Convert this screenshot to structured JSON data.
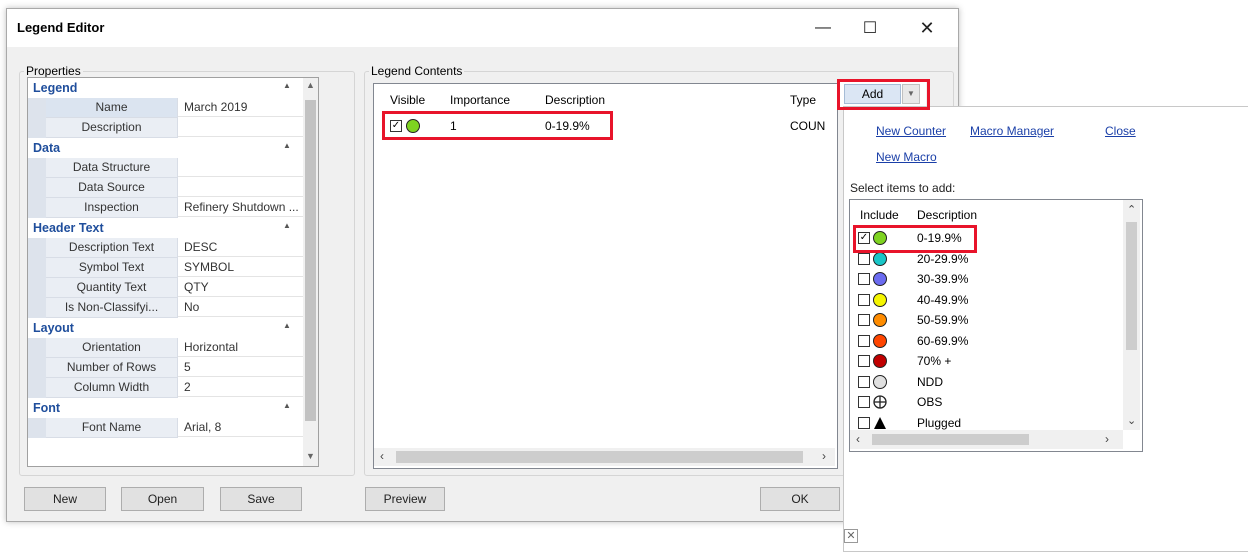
{
  "window": {
    "title": "Legend Editor",
    "minimize_icon": "minimize-icon",
    "maximize_icon": "maximize-icon",
    "close_icon": "close-icon"
  },
  "properties": {
    "group_label": "Properties",
    "categories": [
      {
        "label": "Legend",
        "rows": [
          {
            "name": "Name",
            "value": "March 2019"
          },
          {
            "name": "Description",
            "value": ""
          }
        ]
      },
      {
        "label": "Data",
        "rows": [
          {
            "name": "Data Structure",
            "value": ""
          },
          {
            "name": "Data Source",
            "value": ""
          },
          {
            "name": "Inspection",
            "value": "Refinery Shutdown ..."
          }
        ]
      },
      {
        "label": "Header Text",
        "rows": [
          {
            "name": "Description Text",
            "value": "DESC"
          },
          {
            "name": "Symbol Text",
            "value": "SYMBOL"
          },
          {
            "name": "Quantity Text",
            "value": "QTY"
          },
          {
            "name": "Is Non-Classifyi...",
            "value": "No"
          }
        ]
      },
      {
        "label": "Layout",
        "rows": [
          {
            "name": "Orientation",
            "value": "Horizontal"
          },
          {
            "name": "Number of Rows",
            "value": "5"
          },
          {
            "name": "Column Width",
            "value": "2"
          }
        ]
      },
      {
        "label": "Font",
        "rows": [
          {
            "name": "Font Name",
            "value": "Arial, 8"
          }
        ]
      }
    ]
  },
  "legend_contents": {
    "group_label": "Legend Contents",
    "columns": {
      "visible": "Visible",
      "importance": "Importance",
      "description": "Description",
      "type": "Type"
    },
    "rows": [
      {
        "visible": true,
        "color": "#7ed321",
        "importance": "1",
        "description": "0-19.9%",
        "type": "COUN"
      }
    ]
  },
  "add_button": {
    "label": "Add"
  },
  "buttons": {
    "new": "New",
    "open": "Open",
    "save": "Save",
    "preview": "Preview",
    "ok": "OK"
  },
  "panel": {
    "links": {
      "new_counter": "New Counter",
      "macro_manager": "Macro Manager",
      "close": "Close",
      "new_macro": "New Macro"
    },
    "select_label": "Select items to add:",
    "columns": {
      "include": "Include",
      "description": "Description"
    },
    "items": [
      {
        "checked": true,
        "color": "#7ed321",
        "label": "0-19.9%",
        "shape": "circle"
      },
      {
        "checked": false,
        "color": "#19c6c8",
        "label": "20-29.9%",
        "shape": "circle"
      },
      {
        "checked": false,
        "color": "#6b6bf0",
        "label": "30-39.9%",
        "shape": "circle"
      },
      {
        "checked": false,
        "color": "#f5f500",
        "label": "40-49.9%",
        "shape": "circle"
      },
      {
        "checked": false,
        "color": "#ff8c00",
        "label": "50-59.9%",
        "shape": "circle"
      },
      {
        "checked": false,
        "color": "#ff4500",
        "label": "60-69.9%",
        "shape": "circle"
      },
      {
        "checked": false,
        "color": "#c00000",
        "label": "70% +",
        "shape": "circle"
      },
      {
        "checked": false,
        "color": "#e0e0e0",
        "label": "NDD",
        "shape": "circle"
      },
      {
        "checked": false,
        "color": "#ffffff",
        "label": "OBS",
        "shape": "crosshair"
      },
      {
        "checked": false,
        "color": "#000000",
        "label": "Plugged",
        "shape": "triangle"
      }
    ]
  }
}
